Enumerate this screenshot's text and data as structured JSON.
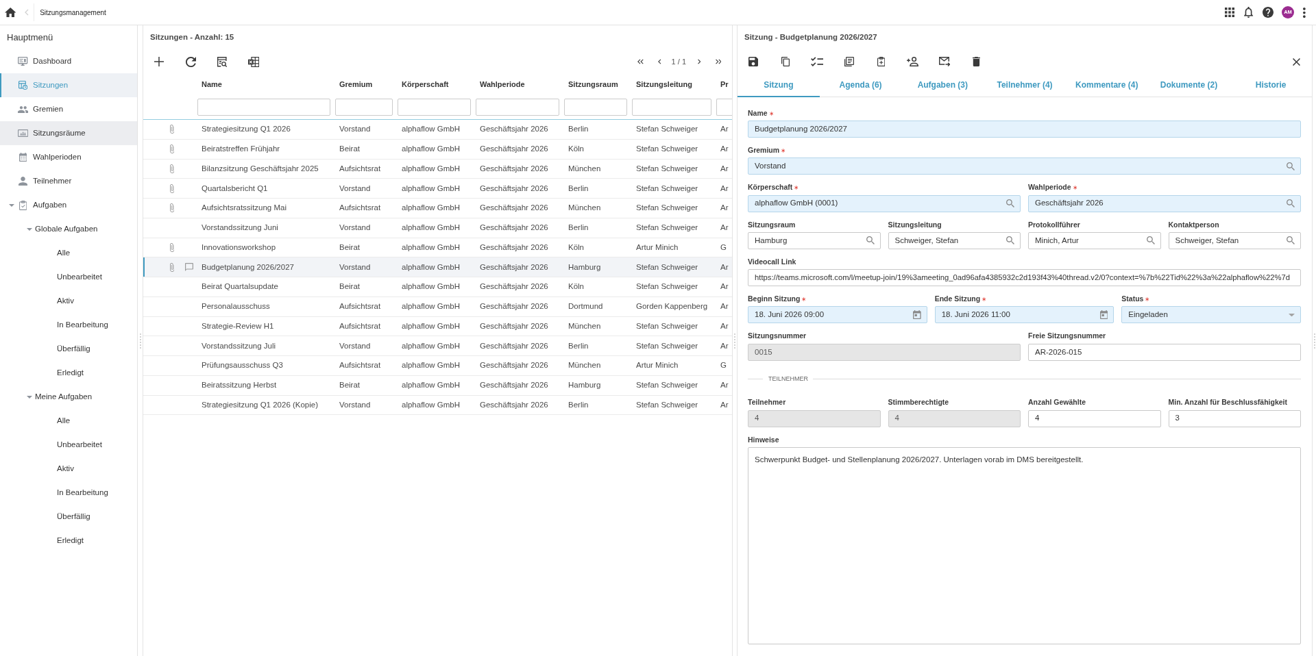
{
  "top_bar": {
    "breadcrumb": "Sitzungsmanagement",
    "avatar": "AM"
  },
  "sidebar": {
    "title": "Hauptmenü",
    "items": [
      {
        "label": "Dashboard",
        "selected": false,
        "hovered": false
      },
      {
        "label": "Sitzungen",
        "selected": true,
        "hovered": false
      },
      {
        "label": "Gremien",
        "selected": false,
        "hovered": false
      },
      {
        "label": "Sitzungsräume",
        "selected": false,
        "hovered": true
      },
      {
        "label": "Wahlperioden",
        "selected": false,
        "hovered": false
      },
      {
        "label": "Teilnehmer",
        "selected": false,
        "hovered": false
      },
      {
        "label": "Aufgaben",
        "selected": false,
        "hovered": false,
        "expanded": true,
        "children": [
          {
            "label": "Globale Aufgaben",
            "selected": false,
            "expanded": true,
            "children": [
              {
                "label": "Alle",
                "selected": false
              },
              {
                "label": "Unbearbeitet",
                "selected": false
              },
              {
                "label": "Aktiv",
                "selected": false
              },
              {
                "label": "In Bearbeitung",
                "selected": false
              },
              {
                "label": "Überfällig",
                "selected": false
              },
              {
                "label": "Erledigt",
                "selected": false
              }
            ]
          },
          {
            "label": "Meine Aufgaben",
            "selected": false,
            "expanded": true,
            "children": [
              {
                "label": "Alle",
                "selected": false
              },
              {
                "label": "Unbearbeitet",
                "selected": false
              },
              {
                "label": "Aktiv",
                "selected": false
              },
              {
                "label": "In Bearbeitung",
                "selected": false
              },
              {
                "label": "Überfällig",
                "selected": false
              },
              {
                "label": "Erledigt",
                "selected": false
              }
            ]
          }
        ]
      }
    ]
  },
  "list": {
    "title": "Sitzungen - Anzahl: 15",
    "page": "1 / 1",
    "columns": [
      "Name",
      "Gremium",
      "Körperschaft",
      "Wahlperiode",
      "Sitzungsraum",
      "Sitzungsleitung",
      "Pr"
    ],
    "rows": [
      {
        "attachment": true,
        "comment": false,
        "selected": false,
        "cells": [
          "Strategiesitzung Q1 2026",
          "Vorstand",
          "alphaflow GmbH",
          "Geschäftsjahr 2026",
          "Berlin",
          "Stefan Schweiger",
          "Ar"
        ]
      },
      {
        "attachment": true,
        "comment": false,
        "selected": false,
        "cells": [
          "Beiratstreffen Frühjahr",
          "Beirat",
          "alphaflow GmbH",
          "Geschäftsjahr 2026",
          "Köln",
          "Stefan Schweiger",
          "Ar"
        ]
      },
      {
        "attachment": true,
        "comment": false,
        "selected": false,
        "cells": [
          "Bilanzsitzung Geschäftsjahr 2025",
          "Aufsichtsrat",
          "alphaflow GmbH",
          "Geschäftsjahr 2026",
          "München",
          "Stefan Schweiger",
          "Ar"
        ]
      },
      {
        "attachment": true,
        "comment": false,
        "selected": false,
        "cells": [
          "Quartalsbericht Q1",
          "Vorstand",
          "alphaflow GmbH",
          "Geschäftsjahr 2026",
          "Berlin",
          "Stefan Schweiger",
          "Ar"
        ]
      },
      {
        "attachment": true,
        "comment": false,
        "selected": false,
        "cells": [
          "Aufsichtsratssitzung Mai",
          "Aufsichtsrat",
          "alphaflow GmbH",
          "Geschäftsjahr 2026",
          "München",
          "Stefan Schweiger",
          "Ar"
        ]
      },
      {
        "attachment": false,
        "comment": false,
        "selected": false,
        "cells": [
          "Vorstandssitzung Juni",
          "Vorstand",
          "alphaflow GmbH",
          "Geschäftsjahr 2026",
          "Berlin",
          "Stefan Schweiger",
          "Ar"
        ]
      },
      {
        "attachment": true,
        "comment": false,
        "selected": false,
        "cells": [
          "Innovationsworkshop",
          "Beirat",
          "alphaflow GmbH",
          "Geschäftsjahr 2026",
          "Köln",
          "Artur Minich",
          "G"
        ]
      },
      {
        "attachment": true,
        "comment": true,
        "selected": true,
        "cells": [
          "Budgetplanung 2026/2027",
          "Vorstand",
          "alphaflow GmbH",
          "Geschäftsjahr 2026",
          "Hamburg",
          "Stefan Schweiger",
          "Ar"
        ]
      },
      {
        "attachment": false,
        "comment": false,
        "selected": false,
        "cells": [
          "Beirat Quartalsupdate",
          "Beirat",
          "alphaflow GmbH",
          "Geschäftsjahr 2026",
          "Köln",
          "Stefan Schweiger",
          "Ar"
        ]
      },
      {
        "attachment": false,
        "comment": false,
        "selected": false,
        "cells": [
          "Personalausschuss",
          "Aufsichtsrat",
          "alphaflow GmbH",
          "Geschäftsjahr 2026",
          "Dortmund",
          "Gorden Kappenberg",
          "Ar"
        ]
      },
      {
        "attachment": false,
        "comment": false,
        "selected": false,
        "cells": [
          "Strategie-Review H1",
          "Aufsichtsrat",
          "alphaflow GmbH",
          "Geschäftsjahr 2026",
          "München",
          "Stefan Schweiger",
          "Ar"
        ]
      },
      {
        "attachment": false,
        "comment": false,
        "selected": false,
        "cells": [
          "Vorstandssitzung Juli",
          "Vorstand",
          "alphaflow GmbH",
          "Geschäftsjahr 2026",
          "Berlin",
          "Stefan Schweiger",
          "Ar"
        ]
      },
      {
        "attachment": false,
        "comment": false,
        "selected": false,
        "cells": [
          "Prüfungsausschuss Q3",
          "Aufsichtsrat",
          "alphaflow GmbH",
          "Geschäftsjahr 2026",
          "München",
          "Artur Minich",
          "G"
        ]
      },
      {
        "attachment": false,
        "comment": false,
        "selected": false,
        "cells": [
          "Beiratssitzung Herbst",
          "Beirat",
          "alphaflow GmbH",
          "Geschäftsjahr 2026",
          "Hamburg",
          "Stefan Schweiger",
          "Ar"
        ]
      },
      {
        "attachment": false,
        "comment": false,
        "selected": false,
        "cells": [
          "Strategiesitzung Q1 2026 (Kopie)",
          "Vorstand",
          "alphaflow GmbH",
          "Geschäftsjahr 2026",
          "Berlin",
          "Stefan Schweiger",
          "Ar"
        ]
      }
    ]
  },
  "detail": {
    "title": "Sitzung - Budgetplanung 2026/2027",
    "tabs": [
      {
        "label": "Sitzung",
        "selected": true
      },
      {
        "label": "Agenda (6)",
        "selected": false
      },
      {
        "label": "Aufgaben (3)",
        "selected": false
      },
      {
        "label": "Teilnehmer (4)",
        "selected": false
      },
      {
        "label": "Kommentare (4)",
        "selected": false
      },
      {
        "label": "Dokumente (2)",
        "selected": false
      },
      {
        "label": "Historie",
        "selected": false
      }
    ],
    "form": [
      {
        "kind": "fields",
        "fields": [
          {
            "label": "Name",
            "kind": "text",
            "required": true,
            "readonly": false,
            "value": "Budgetplanung 2026/2027"
          }
        ]
      },
      {
        "kind": "fields",
        "fields": [
          {
            "label": "Gremium",
            "kind": "lookup",
            "required": true,
            "readonly": false,
            "value": "Vorstand"
          }
        ]
      },
      {
        "kind": "fields",
        "fields": [
          {
            "label": "Körperschaft",
            "kind": "lookup",
            "required": true,
            "readonly": false,
            "value": "alphaflow GmbH (0001)"
          },
          {
            "label": "Wahlperiode",
            "kind": "lookup",
            "required": true,
            "readonly": false,
            "value": "Geschäftsjahr 2026"
          }
        ]
      },
      {
        "kind": "fields",
        "fields": [
          {
            "label": "Sitzungsraum",
            "kind": "lookup",
            "required": false,
            "readonly": false,
            "value": "Hamburg"
          },
          {
            "label": "Sitzungsleitung",
            "kind": "lookup",
            "required": false,
            "readonly": false,
            "value": "Schweiger, Stefan"
          },
          {
            "label": "Protokollführer",
            "kind": "lookup",
            "required": false,
            "readonly": false,
            "value": "Minich, Artur"
          },
          {
            "label": "Kontaktperson",
            "kind": "lookup",
            "required": false,
            "readonly": false,
            "value": "Schweiger, Stefan"
          }
        ]
      },
      {
        "kind": "fields",
        "fields": [
          {
            "label": "Videocall Link",
            "kind": "text",
            "required": false,
            "readonly": false,
            "value": "https://teams.microsoft.com/l/meetup-join/19%3ameeting_0ad96afa4385932c2d193f43%40thread.v2/0?context=%7b%22Tid%22%3a%22alphaflow%22%7d"
          }
        ]
      },
      {
        "kind": "fields",
        "fields": [
          {
            "label": "Beginn Sitzung",
            "kind": "date",
            "required": true,
            "readonly": false,
            "value": "18. Juni 2026 09:00"
          },
          {
            "label": "Ende Sitzung",
            "kind": "date",
            "required": true,
            "readonly": false,
            "value": "18. Juni 2026 11:00"
          },
          {
            "label": "Status",
            "kind": "select",
            "required": true,
            "readonly": false,
            "value": "Eingeladen"
          }
        ]
      },
      {
        "kind": "fields",
        "fields": [
          {
            "label": "Sitzungsnummer",
            "kind": "text",
            "required": false,
            "readonly": true,
            "value": "0015"
          },
          {
            "label": "Freie Sitzungsnummer",
            "kind": "text",
            "required": false,
            "readonly": false,
            "value": "AR-2026-015"
          }
        ]
      },
      {
        "kind": "section",
        "label": "TEILNEHMER"
      },
      {
        "kind": "fields",
        "fields": [
          {
            "label": "Teilnehmer",
            "kind": "text",
            "required": false,
            "readonly": true,
            "value": "4"
          },
          {
            "label": "Stimmberechtigte",
            "kind": "text",
            "required": false,
            "readonly": true,
            "value": "4"
          },
          {
            "label": "Anzahl Gewählte",
            "kind": "text",
            "required": false,
            "readonly": false,
            "value": "4"
          },
          {
            "label": "Min. Anzahl für Beschlussfähigkeit",
            "kind": "text",
            "required": false,
            "readonly": false,
            "value": "3"
          }
        ]
      },
      {
        "kind": "fields",
        "fields": [
          {
            "label": "Hinweise",
            "kind": "textarea",
            "required": false,
            "readonly": false,
            "value": "Schwerpunkt Budget- und Stellenplanung 2026/2027. Unterlagen vorab im DMS bereitgestellt."
          }
        ]
      }
    ]
  }
}
